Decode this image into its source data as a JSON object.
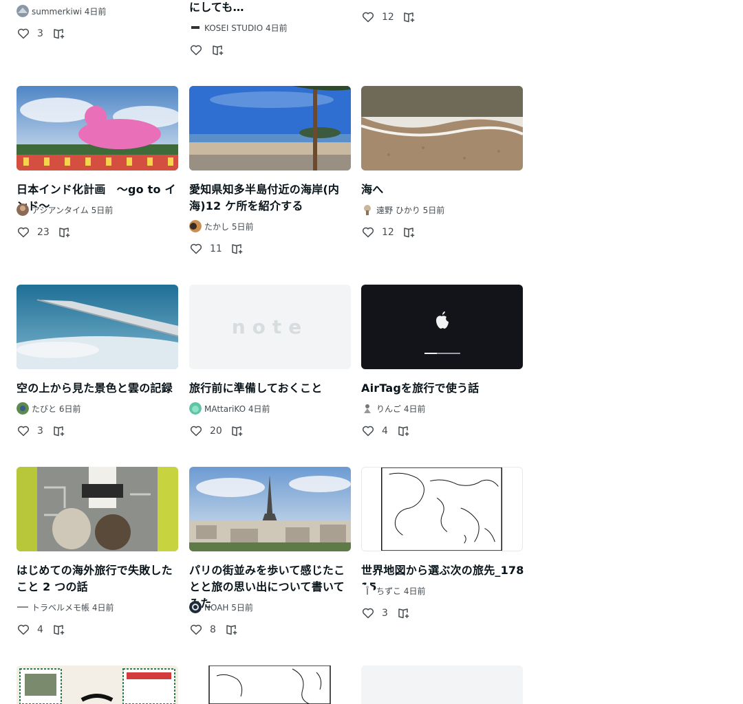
{
  "cards_partial": [
    {
      "id": "p1",
      "author": "summerkiwi 4日前",
      "likes": "3"
    },
    {
      "id": "p2",
      "title": "にしても…",
      "author": "KOSEI STUDIO 4日前",
      "likes": ""
    },
    {
      "id": "p3",
      "author": "",
      "likes": "12"
    }
  ],
  "cards": [
    {
      "id": "c1",
      "title": "日本インド化計画　〜go to インド〜",
      "author": "アジアンタイム 5日前",
      "likes": "23"
    },
    {
      "id": "c2",
      "title": "愛知県知多半島付近の海岸(内海)12 ケ所を紹介する",
      "author": "たかし 5日前",
      "likes": "11"
    },
    {
      "id": "c3",
      "title": "海へ",
      "author": "遠野 ひかり 5日前",
      "likes": "12"
    },
    {
      "id": "c4",
      "title": "空の上から見た景色と雲の記録",
      "author": "たびと 6日前",
      "likes": "3"
    },
    {
      "id": "c5",
      "title": "旅行前に準備しておくこと",
      "author": "MAttariKO 4日前",
      "likes": "20"
    },
    {
      "id": "c6",
      "title": "AirTagを旅行で使う話",
      "author": "りんご 4日前",
      "likes": "4"
    },
    {
      "id": "c7",
      "title": "はじめての海外旅行で失敗したこと 2 つの話",
      "author": "トラベルメモ帳 4日前",
      "likes": "4"
    },
    {
      "id": "c8",
      "title": "パリの街並みを歩いて感じたことと旅の思い出について書いてみた",
      "author": "NOAH 5日前",
      "likes": "8"
    },
    {
      "id": "c9",
      "title": "世界地図から選ぶ次の旅先_17815",
      "author": "ちずこ 4日前",
      "likes": "3"
    }
  ],
  "placeholder_logo": "note",
  "icons": {
    "like": "heart-outline-icon",
    "save": "magazine-add-icon"
  },
  "colors": {
    "text": "#08131a",
    "subtext": "#434a4f",
    "icon": "#434a4f",
    "placeholder_bg": "#f2f4f5",
    "placeholder_logo": "#d7dcdf"
  }
}
